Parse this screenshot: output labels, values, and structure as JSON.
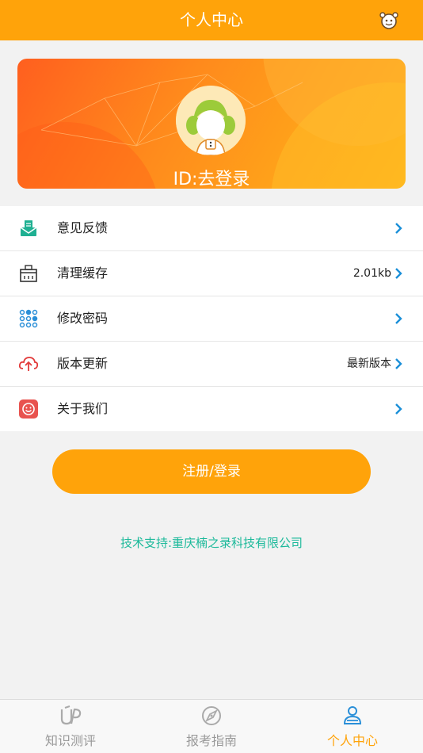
{
  "header": {
    "title": "个人中心"
  },
  "profile": {
    "id_text": "ID:去登录"
  },
  "menu": [
    {
      "label": "意见反馈",
      "value": "",
      "icon": "feedback-icon"
    },
    {
      "label": "清理缓存",
      "value": "2.01kb",
      "icon": "cache-icon"
    },
    {
      "label": "修改密码",
      "value": "",
      "icon": "password-icon"
    },
    {
      "label": "版本更新",
      "value": "最新版本",
      "icon": "cloud-upload-icon"
    },
    {
      "label": "关于我们",
      "value": "",
      "icon": "about-icon"
    }
  ],
  "login_button": "注册/登录",
  "support_text": "技术支持:重庆楠之录科技有限公司",
  "tabs": [
    {
      "label": "知识测评",
      "active": false
    },
    {
      "label": "报考指南",
      "active": false
    },
    {
      "label": "个人中心",
      "active": true
    }
  ],
  "colors": {
    "accent": "#ffa30a",
    "support_text": "#1bb99a",
    "chevron": "#1a8fd8"
  }
}
